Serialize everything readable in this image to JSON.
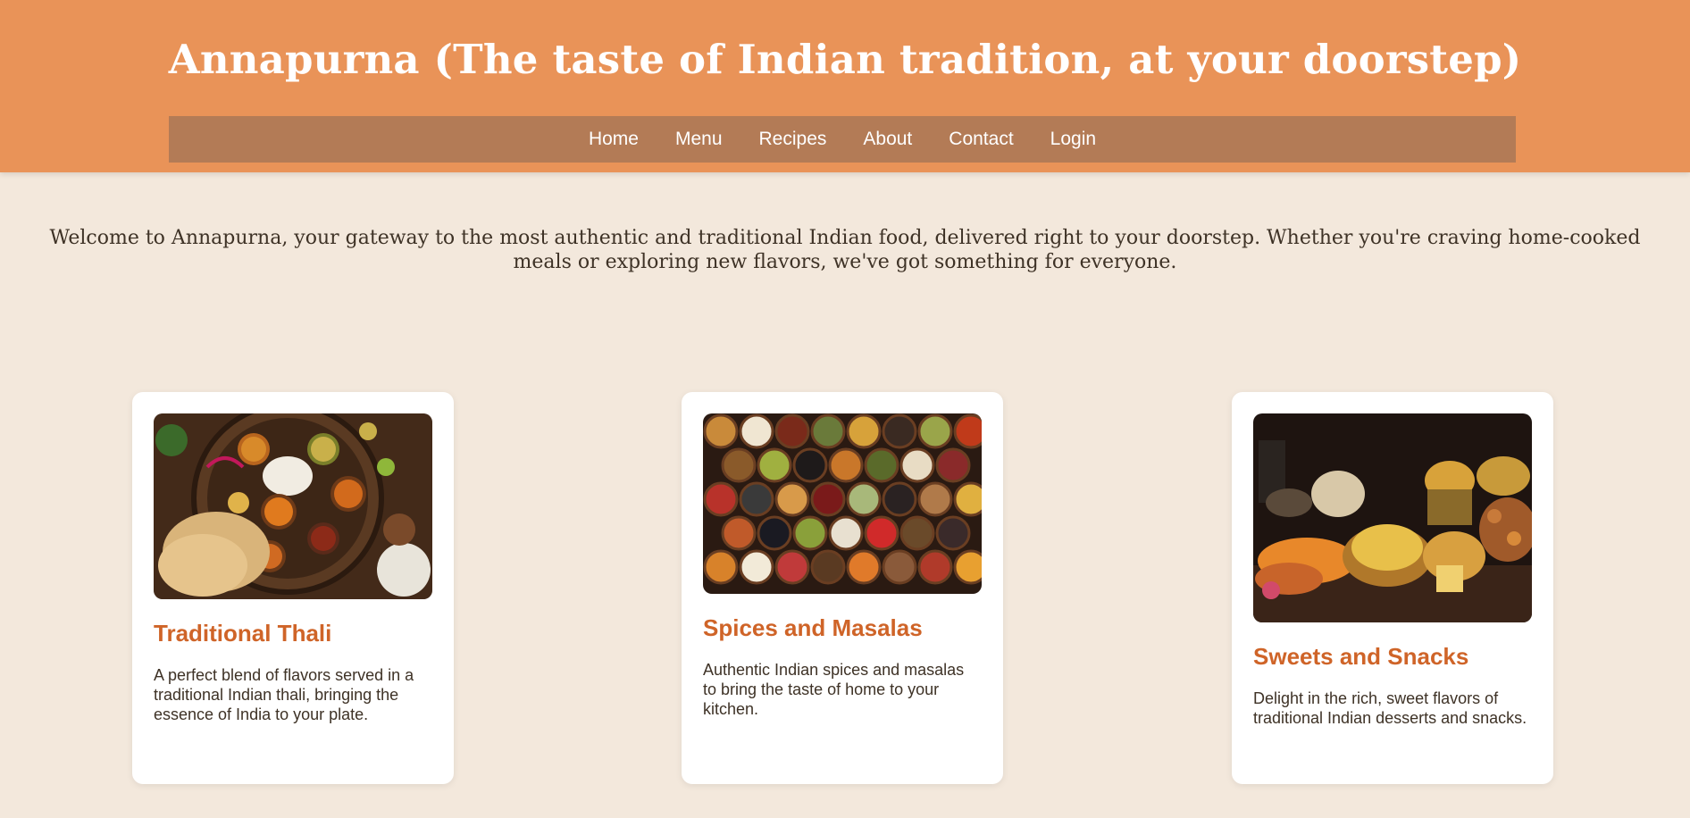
{
  "header": {
    "title": "Annapurna (The taste of Indian tradition, at your doorstep)"
  },
  "nav": {
    "items": [
      {
        "label": "Home"
      },
      {
        "label": "Menu"
      },
      {
        "label": "Recipes"
      },
      {
        "label": "About"
      },
      {
        "label": "Contact"
      },
      {
        "label": "Login"
      }
    ]
  },
  "welcome": {
    "text": "Welcome to Annapurna, your gateway to the most authentic and traditional Indian food, delivered right to your doorstep. Whether you're craving home-cooked meals or exploring new flavors, we've got something for everyone."
  },
  "cards": [
    {
      "image_icon": "thali-image",
      "title": "Traditional Thali",
      "description": "A perfect blend of flavors served in a traditional Indian thali, bringing the essence of India to your plate."
    },
    {
      "image_icon": "spices-image",
      "title": "Spices and Masalas",
      "description": "Authentic Indian spices and masalas to bring the taste of home to your kitchen."
    },
    {
      "image_icon": "sweets-image",
      "title": "Sweets and Snacks",
      "description": "Delight in the rich, sweet flavors of traditional Indian desserts and snacks."
    }
  ],
  "colors": {
    "header_bg": "#e99358",
    "nav_bg": "#b37b56",
    "page_bg": "#f3e8dc",
    "accent": "#cf6428"
  }
}
